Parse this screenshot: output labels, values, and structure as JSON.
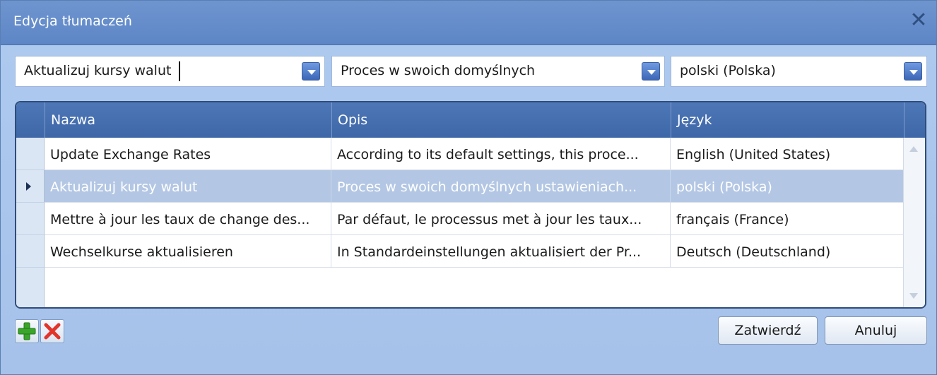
{
  "window": {
    "title": "Edycja tłumaczeń"
  },
  "filters": {
    "name_value": "Aktualizuj kursy walut",
    "desc_value": "Proces w swoich domyślnych",
    "lang_value": "polski (Polska)"
  },
  "grid": {
    "columns": [
      "Nazwa",
      "Opis",
      "Język"
    ],
    "rows": [
      {
        "name": "Update Exchange Rates",
        "desc": "According to its default settings, this proce...",
        "lang": "English (United States)"
      },
      {
        "name": "Aktualizuj kursy walut",
        "desc": "Proces w swoich domyślnych ustawieniach...",
        "lang": "polski (Polska)"
      },
      {
        "name": "Mettre à jour les taux de change des...",
        "desc": "Par défaut, le processus met à jour les taux...",
        "lang": "français (France)"
      },
      {
        "name": "Wechselkurse aktualisieren",
        "desc": "In Standardeinstellungen aktualisiert der Pr...",
        "lang": "Deutsch (Deutschland)"
      }
    ],
    "selected_row_index": 1
  },
  "buttons": {
    "confirm": "Zatwierdź",
    "cancel": "Anuluj"
  },
  "icons": {
    "add": "plus-icon",
    "delete": "x-icon",
    "close": "close-icon"
  },
  "colors": {
    "accent": "#4e77b7",
    "add_green": "#3aa52a",
    "delete_red": "#e2342b"
  }
}
